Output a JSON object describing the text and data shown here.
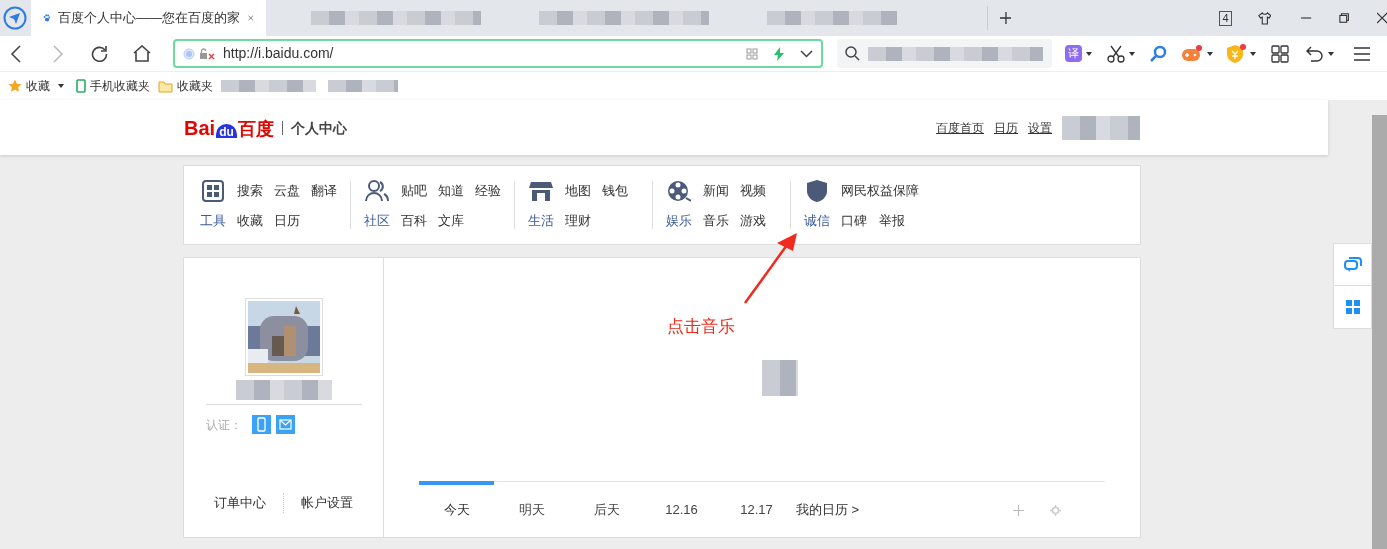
{
  "browser": {
    "tab": {
      "title": "百度个人中心——您在百度的家",
      "selected": true
    },
    "tab_count": "4",
    "url": "http://i.baidu.com/",
    "translate_label": "译",
    "bookmarks": [
      {
        "label": "收藏",
        "kind": "star"
      },
      {
        "label": "手机收藏夹",
        "kind": "phone"
      },
      {
        "label": "收藏夹",
        "kind": "folder"
      }
    ]
  },
  "header": {
    "logo": {
      "part1": "Bai",
      "part2": "du",
      "part3": "百度",
      "subtitle": "个人中心"
    },
    "links": [
      "百度首页",
      "日历",
      "设置"
    ]
  },
  "nav_groups": [
    {
      "kind": "grid",
      "label": "工具",
      "row1": [
        "搜索",
        "云盘",
        "翻译"
      ],
      "row2": [
        "收藏",
        "日历"
      ]
    },
    {
      "kind": "people",
      "label": "社区",
      "row1": [
        "贴吧",
        "知道",
        "经验"
      ],
      "row2": [
        "百科",
        "文库"
      ]
    },
    {
      "kind": "shop",
      "label": "生活",
      "row1": [
        "地图",
        "钱包"
      ],
      "row2": [
        "理财"
      ]
    },
    {
      "kind": "film",
      "label": "娱乐",
      "row1": [
        "新闻",
        "视频"
      ],
      "row2": [
        "音乐",
        "游戏"
      ]
    },
    {
      "kind": "shield",
      "label": "诚信",
      "row1": [
        "网民权益保障"
      ],
      "row2": [
        "口碑",
        "举报"
      ]
    }
  ],
  "profile": {
    "verify_label": "认证：",
    "links": [
      "订单中心",
      "帐户设置"
    ]
  },
  "calendar": {
    "tabs": [
      {
        "label": "今天",
        "selected": true
      },
      {
        "label": "明天",
        "selected": false
      },
      {
        "label": "后天",
        "selected": false
      },
      {
        "label": "12.16",
        "selected": false
      },
      {
        "label": "12.17",
        "selected": false
      }
    ],
    "more_link": "我的日历 >"
  },
  "annotation": {
    "text": "点击音乐"
  }
}
